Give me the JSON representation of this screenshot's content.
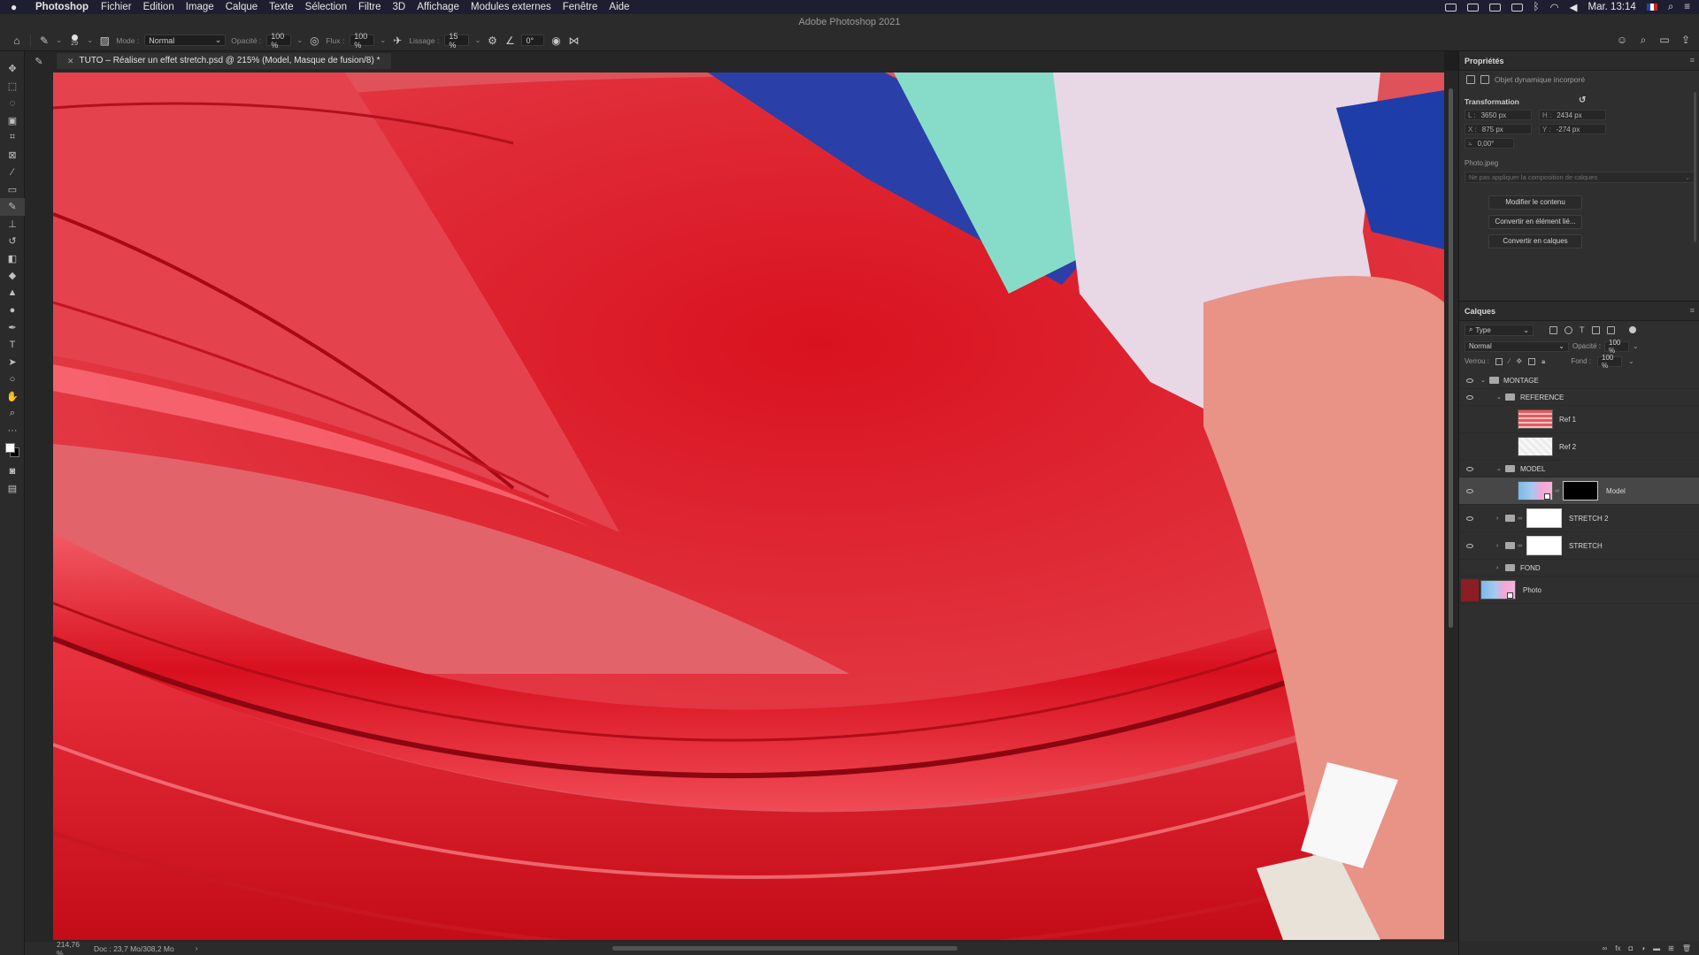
{
  "menubar": {
    "app_name": "Photoshop",
    "items": [
      "Fichier",
      "Edition",
      "Image",
      "Calque",
      "Texte",
      "Sélection",
      "Filtre",
      "3D",
      "Affichage",
      "Modules externes",
      "Fenêtre",
      "Aide"
    ],
    "clock": "Mar. 13:14"
  },
  "window": {
    "title": "Adobe Photoshop 2021"
  },
  "options": {
    "brush_size": "29",
    "mode_label": "Mode :",
    "mode_value": "Normal",
    "opacity_label": "Opacité :",
    "opacity_value": "100 %",
    "flux_label": "Flux :",
    "flux_value": "100 %",
    "smoothing_label": "Lissage :",
    "smoothing_value": "15 %",
    "angle_value": "0°"
  },
  "document": {
    "tab_title": "TUTO – Réaliser un effet stretch.psd @ 215% (Model, Masque de fusion/8) *"
  },
  "status": {
    "zoom": "214,76 %",
    "doc_size": "Doc : 23,7 Mo/308,2 Mo",
    "arrow": "›"
  },
  "colors": {
    "foreground": "#ffffff",
    "background": "#000000",
    "canvas_red": "#e0525a"
  },
  "properties": {
    "title": "Propriétés",
    "object_type": "Objet dynamique incorporé",
    "transform_title": "Transformation",
    "w": {
      "key": "L :",
      "value": "3650 px"
    },
    "h": {
      "key": "H :",
      "value": "2434 px"
    },
    "x": {
      "key": "X :",
      "value": "875 px"
    },
    "y": {
      "key": "Y :",
      "value": "-274 px"
    },
    "angle": {
      "key": "⦣",
      "value": "0,00°"
    },
    "file_name": "Photo.jpeg",
    "comp_placeholder": "Ne pas appliquer la composition de calques",
    "buttons": [
      "Modifier le contenu",
      "Convertir en élément lié...",
      "Convertir en calques"
    ]
  },
  "layers": {
    "title": "Calques",
    "filter_value": "Type",
    "blend_mode": "Normal",
    "opacity_label": "Opacité :",
    "opacity_value": "100 %",
    "lock_label": "Verrou :",
    "fill_label": "Fond :",
    "fill_value": "100 %",
    "items": [
      {
        "name": "MONTAGE",
        "kind": "group"
      },
      {
        "name": "REFERENCE",
        "kind": "group"
      },
      {
        "name": "Ref 1",
        "kind": "layer"
      },
      {
        "name": "Ref 2",
        "kind": "layer"
      },
      {
        "name": "MODEL",
        "kind": "group"
      },
      {
        "name": "Model",
        "kind": "smart-masked",
        "selected": true
      },
      {
        "name": "STRETCH 2",
        "kind": "group-masked"
      },
      {
        "name": "STRETCH",
        "kind": "group-masked"
      },
      {
        "name": "FOND",
        "kind": "group"
      },
      {
        "name": "Photo",
        "kind": "smart"
      }
    ]
  },
  "icons": {
    "apple": "apple-logo-icon",
    "home": "home-icon",
    "brush": "brush-icon",
    "close": "close-icon"
  }
}
